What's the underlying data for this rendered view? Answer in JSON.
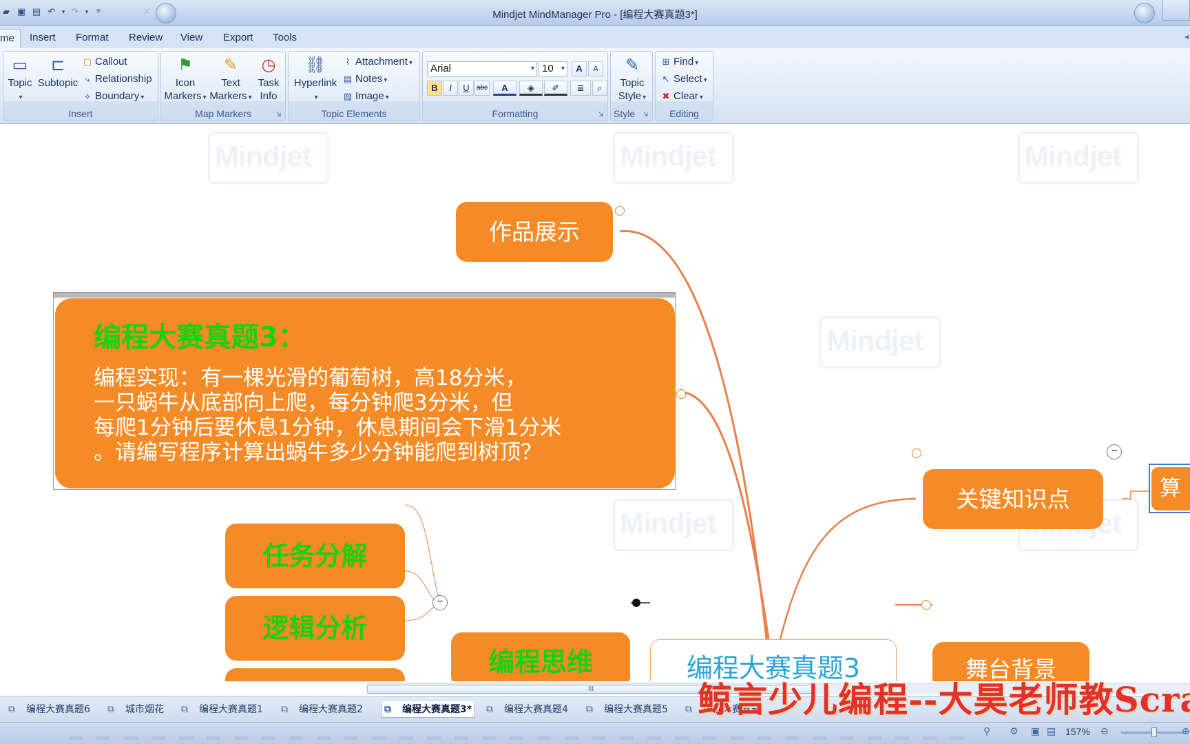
{
  "window": {
    "title": "Mindjet MindManager Pro - [编程大赛真题3*]"
  },
  "ribbon_tabs": [
    "me",
    "Insert",
    "Format",
    "Review",
    "View",
    "Export",
    "Tools"
  ],
  "ribbon": {
    "insert": {
      "topic": "Topic",
      "subtopic": "Subtopic",
      "callout": "Callout",
      "relationship": "Relationship",
      "boundary": "Boundary",
      "label": "Insert"
    },
    "map_markers": {
      "icon_markers_1": "Icon",
      "icon_markers_2": "Markers",
      "text_markers_1": "Text",
      "text_markers_2": "Markers",
      "task_info_1": "Task",
      "task_info_2": "Info",
      "label": "Map Markers"
    },
    "topic_elements": {
      "hyperlink": "Hyperlink",
      "attachment": "Attachment",
      "notes": "Notes",
      "image": "Image",
      "label": "Topic Elements"
    },
    "formatting": {
      "font": "Arial",
      "size": "10",
      "grow": "A",
      "shrink": "A",
      "bold": "B",
      "italic": "I",
      "underline": "U",
      "strike": "abc",
      "font_color": "A",
      "label": "Formatting"
    },
    "style": {
      "topic_style_1": "Topic",
      "topic_style_2": "Style",
      "label": "Style"
    },
    "editing": {
      "find": "Find",
      "select": "Select",
      "clear": "Clear",
      "label": "Editing"
    }
  },
  "map": {
    "central": "编程大赛真题3",
    "topics": {
      "works": "作品展示",
      "key_points": "关键知识点",
      "stage": "舞台背景",
      "thinking": "编程思维",
      "task_decomp": "任务分解",
      "logic": "逻辑分析",
      "right_cut": "算"
    },
    "problem": {
      "title": "编程大赛真题3：",
      "lines": [
        "编程实现：有一棵光滑的葡萄树，高18分米，",
        "一只蜗牛从底部向上爬，每分钟爬3分米，但",
        "每爬1分钟后要休息1分钟，休息期间会下滑1分米",
        "。请编写程序计算出蜗牛多少分钟能爬到树顶？"
      ]
    },
    "watermark": "Mindjet"
  },
  "scrollbar": {
    "grip": "III"
  },
  "doc_tabs": [
    "编程大赛真题6",
    "城市烟花",
    "编程大赛真题1",
    "编程大赛真题2",
    "编程大赛真题3*",
    "编程大赛真题4",
    "编程大赛真题5",
    "编程大赛真题"
  ],
  "banner": "鲸言少儿编程--大昊老师教Scrat",
  "status": {
    "zoom": "157%"
  },
  "colors": {
    "topic_orange": "#f58b26",
    "topic_green_text": "#18d10f",
    "central_text": "#2aa4d8",
    "branch_line": "#e8804a",
    "banner_red": "#e0322a"
  }
}
